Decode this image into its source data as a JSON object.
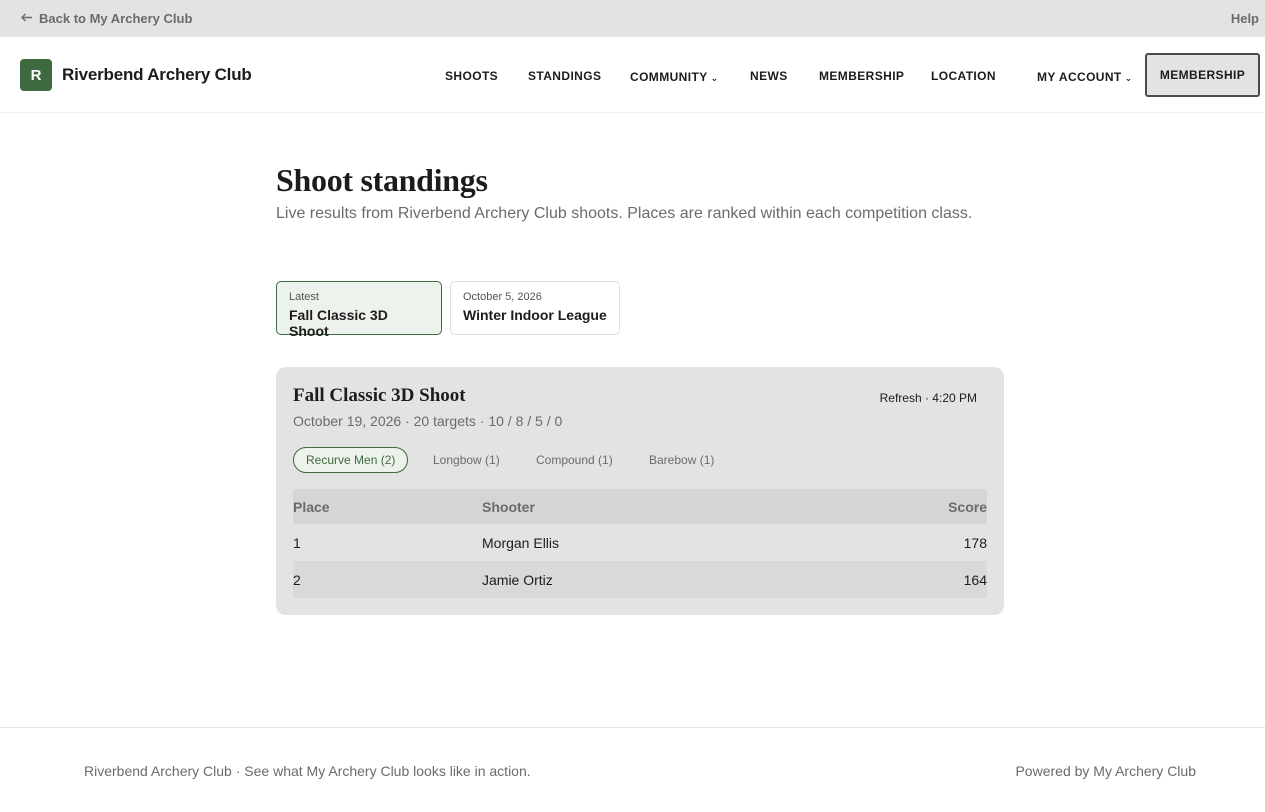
{
  "utility": {
    "back_label": "Back to My Archery Club",
    "help_label": "Help"
  },
  "brand": {
    "logo_letter": "R",
    "name": "Riverbend Archery Club",
    "color": "#3d6b3f"
  },
  "nav": {
    "shoots": "SHOOTS",
    "standings": "STANDINGS",
    "community": "COMMUNITY",
    "news": "NEWS",
    "membership": "MEMBERSHIP",
    "location": "LOCATION",
    "account": "MY ACCOUNT",
    "chevron": "⌄",
    "cta": "MEMBERSHIP"
  },
  "main": {
    "title": "Shoot standings",
    "subtitle": "Live results from Riverbend Archery Club shoots. Places are ranked within each competition class."
  },
  "events": [
    {
      "tag": "Latest",
      "name": "Fall Classic 3D Shoot",
      "selected": true
    },
    {
      "tag": "October 5, 2026",
      "name": "Winter Indoor League",
      "selected": false
    }
  ],
  "panel": {
    "title": "Fall Classic 3D Shoot",
    "meta": "October 19, 2026 · 20 targets · 10 / 8 / 5 / 0",
    "refresh": "Refresh · 4:20 PM",
    "classes": [
      {
        "label": "Recurve Men (2)",
        "selected": true
      },
      {
        "label": "Longbow (1)",
        "selected": false
      },
      {
        "label": "Compound (1)",
        "selected": false
      },
      {
        "label": "Barebow (1)",
        "selected": false
      }
    ],
    "columns": {
      "place": "Place",
      "shooter": "Shooter",
      "score": "Score"
    },
    "rows": [
      {
        "place": "1",
        "shooter": "Morgan Ellis",
        "score": "178"
      },
      {
        "place": "2",
        "shooter": "Jamie Ortiz",
        "score": "164"
      }
    ]
  },
  "footer": {
    "left": "Riverbend Archery Club · See what My Archery Club looks like in action.",
    "right": "Powered by My Archery Club"
  }
}
